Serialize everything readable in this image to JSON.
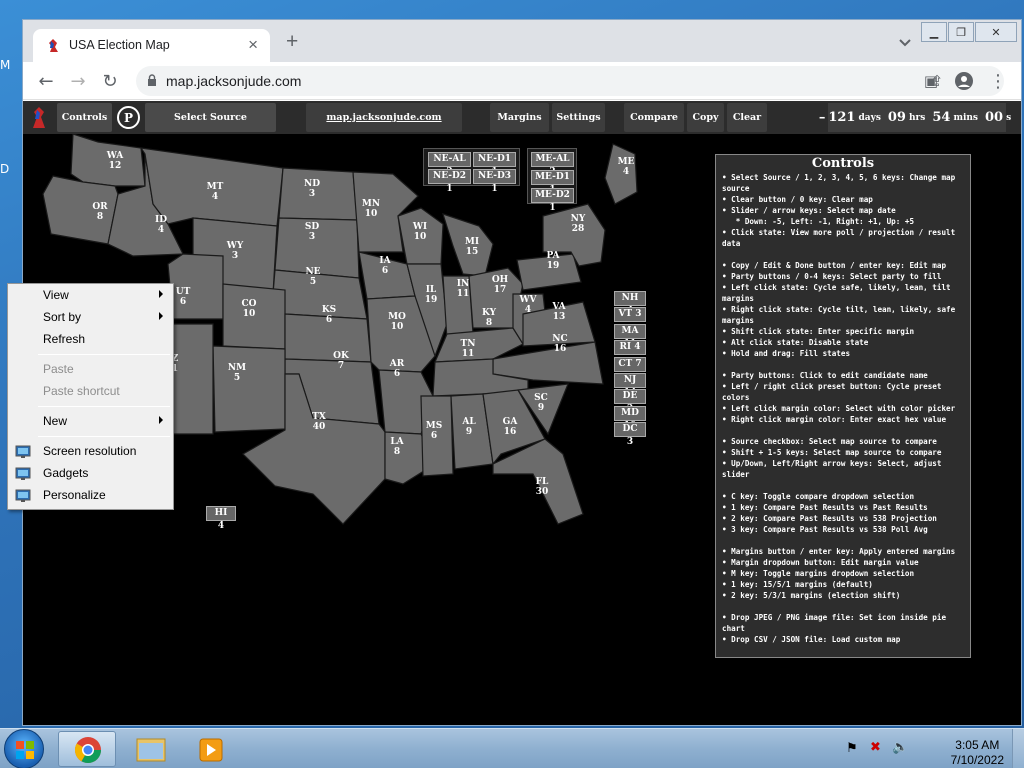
{
  "browser": {
    "tab_title": "USA Election Map",
    "new_tab": "+",
    "url": "map.jacksonjude.com"
  },
  "navbar": {
    "controls": "Controls",
    "p_button": "P",
    "select_source": "Select Source",
    "site_link": "map.jacksonjude.com",
    "margins": "Margins",
    "settings": "Settings",
    "compare": "Compare",
    "copy": "Copy",
    "clear": "Clear",
    "countdown": {
      "prefix": "–",
      "days": "121",
      "days_unit": "days",
      "hrs": "09",
      "hrs_unit": "hrs",
      "mins": "54",
      "mins_unit": "mins",
      "secs": "00",
      "secs_unit": "s"
    }
  },
  "map": {
    "fill_color": "#6b6b6b",
    "border_color": "#1a1a1a",
    "states": [
      {
        "abbr": "WA",
        "ev": "12"
      },
      {
        "abbr": "OR",
        "ev": "8"
      },
      {
        "abbr": "ID",
        "ev": "4"
      },
      {
        "abbr": "MT",
        "ev": "4"
      },
      {
        "abbr": "WY",
        "ev": "3"
      },
      {
        "abbr": "ND",
        "ev": "3"
      },
      {
        "abbr": "SD",
        "ev": "3"
      },
      {
        "abbr": "NE",
        "ev": "5"
      },
      {
        "abbr": "MN",
        "ev": "10"
      },
      {
        "abbr": "WI",
        "ev": "10"
      },
      {
        "abbr": "MI",
        "ev": "15"
      },
      {
        "abbr": "IA",
        "ev": "6"
      },
      {
        "abbr": "IL",
        "ev": "19"
      },
      {
        "abbr": "IN",
        "ev": "11"
      },
      {
        "abbr": "OH",
        "ev": "17"
      },
      {
        "abbr": "PA",
        "ev": "19"
      },
      {
        "abbr": "NY",
        "ev": "28"
      },
      {
        "abbr": "ME",
        "ev": "4"
      },
      {
        "abbr": "UT",
        "ev": "6"
      },
      {
        "abbr": "CO",
        "ev": "10"
      },
      {
        "abbr": "KS",
        "ev": "6"
      },
      {
        "abbr": "MO",
        "ev": "10"
      },
      {
        "abbr": "KY",
        "ev": "8"
      },
      {
        "abbr": "WV",
        "ev": "4"
      },
      {
        "abbr": "VA",
        "ev": "13"
      },
      {
        "abbr": "NC",
        "ev": "16"
      },
      {
        "abbr": "TN",
        "ev": "11"
      },
      {
        "abbr": "OK",
        "ev": "7"
      },
      {
        "abbr": "AR",
        "ev": "6"
      },
      {
        "abbr": "NM",
        "ev": "5"
      },
      {
        "abbr": "Z",
        "ev": "1"
      },
      {
        "abbr": "TX",
        "ev": "40"
      },
      {
        "abbr": "LA",
        "ev": "8"
      },
      {
        "abbr": "MS",
        "ev": "6"
      },
      {
        "abbr": "AL",
        "ev": "9"
      },
      {
        "abbr": "GA",
        "ev": "16"
      },
      {
        "abbr": "SC",
        "ev": "9"
      },
      {
        "abbr": "FL",
        "ev": "30"
      }
    ],
    "hawaii": "HI 4",
    "districts_ne": [
      "NE-AL 2",
      "NE-D1 1",
      "NE-D2 1",
      "NE-D3 1"
    ],
    "districts_me": [
      "ME-AL 2",
      "ME-D1 1",
      "ME-D2 1"
    ],
    "small_states": [
      "NH 4",
      "VT 3",
      "MA 11",
      "RI 4",
      "CT 7",
      "NJ 14",
      "DE 3",
      "MD 10",
      "DC 3"
    ]
  },
  "controls": {
    "title": "Controls",
    "lines": [
      "• Select Source / 1, 2, 3, 4, 5, 6 keys: Change map source",
      "• Clear button / 0 key: Clear map",
      "• Slider / arrow keys: Select map date",
      "   * Down: -5, Left: -1, Right: +1, Up: +5",
      "• Click state: View more poll / projection / result data",
      "",
      "• Copy / Edit & Done button / enter key: Edit map",
      "• Party buttons / 0-4 keys: Select party to fill",
      "• Left click state: Cycle safe, likely, lean, tilt margins",
      "• Right click state: Cycle tilt, lean, likely, safe margins",
      "• Shift click state: Enter specific margin",
      "• Alt click state: Disable state",
      "• Hold and drag: Fill states",
      "",
      "• Party buttons: Click to edit candidate name",
      "• Left / right click preset button: Cycle preset colors",
      "• Left click margin color: Select with color picker",
      "• Right click margin color: Enter exact hex value",
      "",
      "• Source checkbox: Select map source to compare",
      "• Shift + 1-5 keys: Select map source to compare",
      "• Up/Down, Left/Right arrow keys: Select, adjust slider",
      "",
      "• C key: Toggle compare dropdown selection",
      "• 1 key: Compare Past Results vs Past Results",
      "• 2 key: Compare Past Results vs 538 Projection",
      "• 3 key: Compare Past Results vs 538 Poll Avg",
      "",
      "• Margins button / enter key: Apply entered margins",
      "• Margin dropdown button: Edit margin value",
      "• M key: Toggle margins dropdown selection",
      "• 1 key: 15/5/1 margins (default)",
      "• 2 key: 5/3/1 margins (election shift)",
      "",
      "• Drop JPEG / PNG image file: Set icon inside pie chart",
      "• Drop CSV / JSON file: Load custom map"
    ]
  },
  "context_menu": {
    "items": [
      {
        "label": "View",
        "submenu": true,
        "enabled": true
      },
      {
        "label": "Sort by",
        "submenu": true,
        "enabled": true
      },
      {
        "label": "Refresh",
        "submenu": false,
        "enabled": true
      },
      {
        "label": "Paste",
        "submenu": false,
        "enabled": false
      },
      {
        "label": "Paste shortcut",
        "submenu": false,
        "enabled": false
      },
      {
        "label": "New",
        "submenu": true,
        "enabled": true
      },
      {
        "label": "Screen resolution",
        "submenu": false,
        "enabled": true,
        "icon": "screen-resolution-icon"
      },
      {
        "label": "Gadgets",
        "submenu": false,
        "enabled": true,
        "icon": "gadgets-icon"
      },
      {
        "label": "Personalize",
        "submenu": false,
        "enabled": true,
        "icon": "personalize-icon"
      }
    ]
  },
  "taskbar": {
    "time": "3:05 AM",
    "date": "7/10/2022"
  },
  "desktop": {
    "edge_glyphs": [
      "M",
      "D"
    ]
  }
}
